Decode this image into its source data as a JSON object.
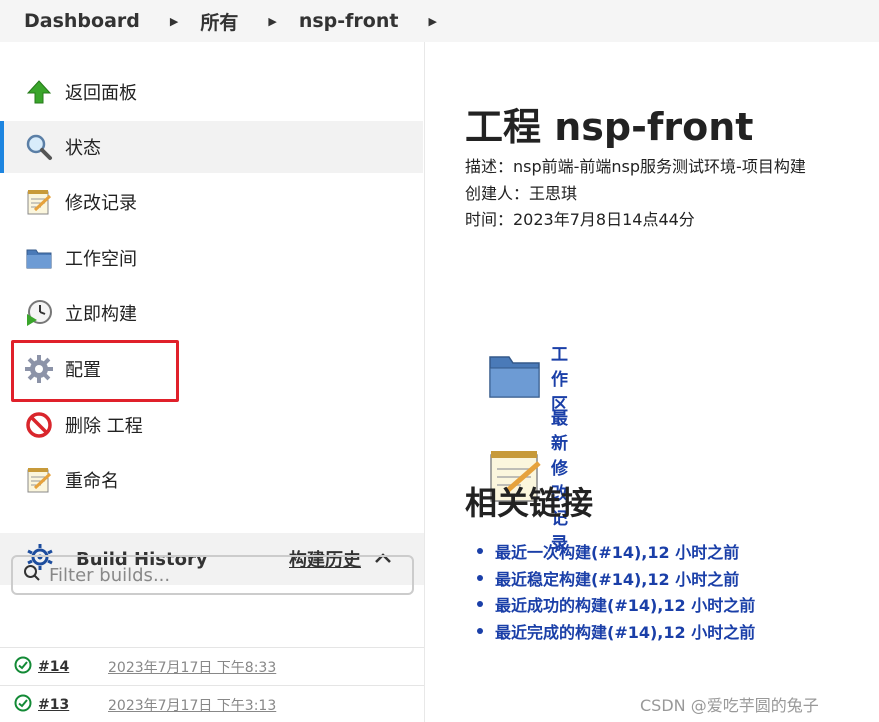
{
  "breadcrumb": {
    "items": [
      "Dashboard",
      "所有",
      "nsp-front"
    ]
  },
  "sidebar": {
    "tasks": [
      {
        "label": "返回面板",
        "icon": "up-arrow-icon"
      },
      {
        "label": "状态",
        "icon": "magnifier-icon",
        "active": true
      },
      {
        "label": "修改记录",
        "icon": "notepad-icon"
      },
      {
        "label": "工作空间",
        "icon": "folder-icon"
      },
      {
        "label": "立即构建",
        "icon": "clock-play-icon"
      },
      {
        "label": "配置",
        "icon": "gear-icon",
        "highlighted": true
      },
      {
        "label": "删除 工程",
        "icon": "no-entry-icon"
      },
      {
        "label": "重命名",
        "icon": "notepad-icon"
      }
    ]
  },
  "build_history": {
    "title": "Build History",
    "trend_label": "构建历史",
    "search_placeholder": "Filter builds...",
    "builds": [
      {
        "number": "#14",
        "time": "2023年7月17日 下午8:33",
        "status": "success"
      },
      {
        "number": "#13",
        "time": "2023年7月17日 下午3:13",
        "status": "success"
      }
    ]
  },
  "main": {
    "title": "工程 nsp-front",
    "description": "描述：nsp前端-前端nsp服务测试环境-项目构建",
    "creator": "创建人：王思琪",
    "time": "时间：2023年7月8日14点44分",
    "workspace_link": "工作区",
    "changes_link": "最新修改记录",
    "related_heading": "相关链接",
    "related_links": [
      "最近一次构建(#14),12 小时之前",
      "最近稳定构建(#14),12 小时之前",
      "最近成功的构建(#14),12 小时之前",
      "最近完成的构建(#14),12 小时之前"
    ]
  },
  "watermark": "CSDN @爱吃芋圆的兔子",
  "colors": {
    "link": "#1a3fa8",
    "active_indicator": "#1d85e0",
    "highlight_box": "#e0202a",
    "success": "#138a36"
  }
}
